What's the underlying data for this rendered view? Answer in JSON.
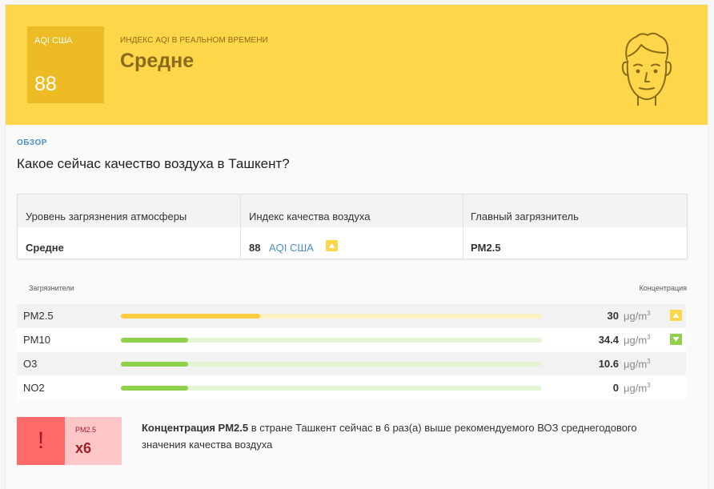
{
  "banner": {
    "aqi_label": "AQI США",
    "aqi_value": "88",
    "realtime_label": "ИНДЕКС AQI В РЕАЛЬНОМ ВРЕМЕНИ",
    "level": "Средне",
    "bg_color": "#fed649",
    "box_color": "#edbc24"
  },
  "overview": {
    "section_label": "ОБЗОР",
    "question": "Какое сейчас качество воздуха в Ташкент?"
  },
  "summary": {
    "headers": [
      "Уровень загрязнения атмосферы",
      "Индекс качества воздуха",
      "Главный загрязнитель"
    ],
    "pollution_level": "Средне",
    "aqi_value": "88",
    "aqi_unit": "AQI США",
    "main_pollutant": "PM2.5"
  },
  "pollutants": {
    "header_left": "Загрязнители",
    "header_right": "Концентрация",
    "unit": "μg/m",
    "unit_sup": "3",
    "rows": [
      {
        "name": "PM2.5",
        "value": "30",
        "level": 0.33,
        "bar": "#fecc3c",
        "track": "#fcf0c4",
        "trend": "up"
      },
      {
        "name": "PM10",
        "value": "34.4",
        "level": 0.16,
        "bar": "#8fd14a",
        "track": "#e4f5d4",
        "trend": "down"
      },
      {
        "name": "O3",
        "value": "10.6",
        "level": 0.16,
        "bar": "#8fd14a",
        "track": "#e4f5d4",
        "trend": ""
      },
      {
        "name": "NO2",
        "value": "0",
        "level": 0.16,
        "bar": "#8fd14a",
        "track": "#e4f5d4",
        "trend": ""
      }
    ]
  },
  "alert": {
    "icon": "!",
    "pollutant": "PM2.5",
    "multiplier": "x6",
    "text_bold": "Концентрация PM2.5",
    "text_rest": " в стране Ташкент сейчас в 6 раз(а) выше рекомендуемого ВОЗ среднегодового значения качества воздуха"
  }
}
